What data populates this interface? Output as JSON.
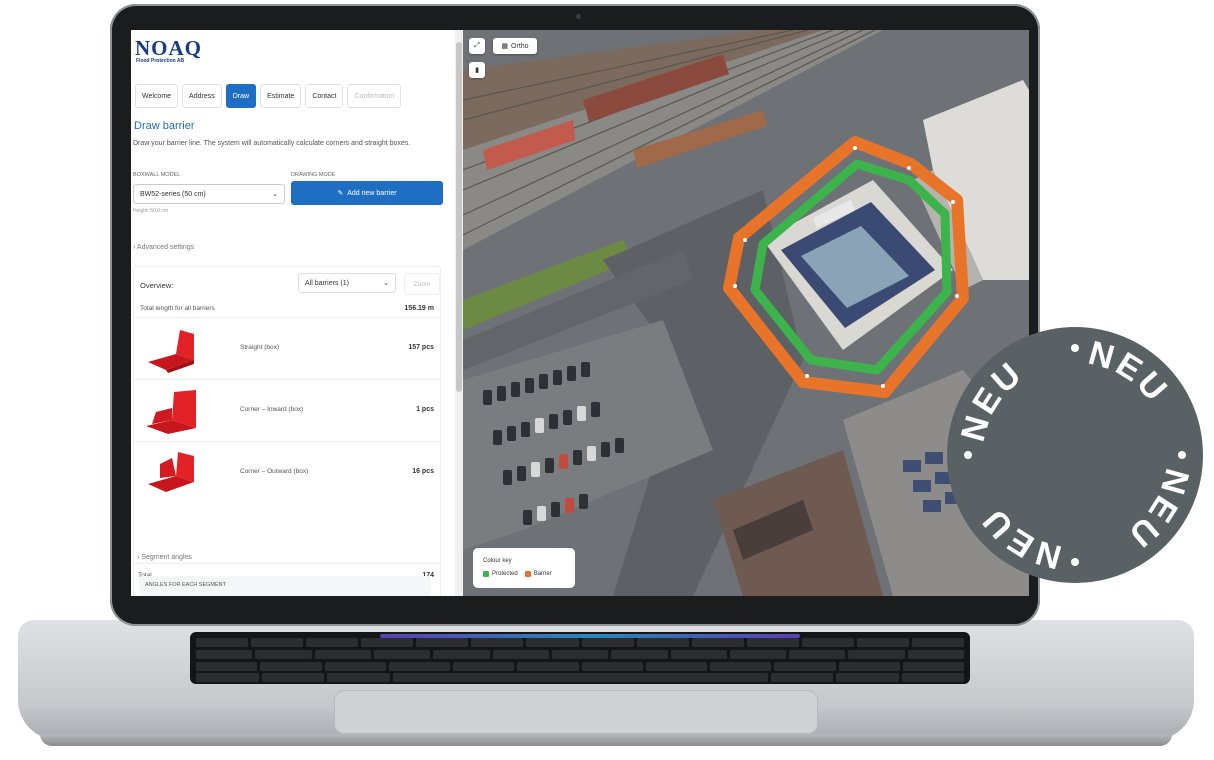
{
  "brand": {
    "logo": "NOAQ",
    "subtitle": "Flood Protection AB"
  },
  "tabs": [
    {
      "label": "Welcome",
      "state": "normal"
    },
    {
      "label": "Address",
      "state": "normal"
    },
    {
      "label": "Draw",
      "state": "active"
    },
    {
      "label": "Estimate",
      "state": "normal"
    },
    {
      "label": "Contact",
      "state": "normal"
    },
    {
      "label": "Confirmation",
      "state": "disabled"
    }
  ],
  "draw": {
    "title": "Draw barrier",
    "description": "Draw your barrier line. The system will automatically calculate corners and straight boxes.",
    "boxwall_label": "BOXWALL MODEL",
    "boxwall_value": "BW52-series (50 cm)",
    "height_hint": "Height: 50,0 cm",
    "mode_label": "DRAWING MODE",
    "add_button": "Add new barrier",
    "advanced": "Advanced settings"
  },
  "overview": {
    "title": "Overview:",
    "filter_value": "All barriers (1)",
    "zoom_label": "Zoom",
    "total_length_label": "Total length for all barriers",
    "total_length_value": "156.19 m",
    "items": [
      {
        "name": "Straight (box)",
        "count": "157 pcs"
      },
      {
        "name": "Corner – Inward (box)",
        "count": "1 pcs"
      },
      {
        "name": "Corner – Outward (box)",
        "count": "16 pcs"
      }
    ],
    "total_label": "Total",
    "total_value": "174",
    "segment_angles": "Segment angles",
    "angles_header": "ANGLES FOR EACH SEGMENT"
  },
  "map": {
    "layer_button": "Ortho",
    "legend_title": "Colour key",
    "legend_protected": "Protected",
    "legend_barrier": "Barrier",
    "colors": {
      "protected": "#3cb44b",
      "barrier": "#e8742a"
    }
  },
  "badge": {
    "words": [
      "NEU",
      "NEU",
      "NEU",
      "NEU"
    ],
    "color": "#5a6164"
  },
  "icons": [
    "expand-icon",
    "trash-icon",
    "grid-icon",
    "pencil-icon",
    "chevron-down-icon"
  ]
}
